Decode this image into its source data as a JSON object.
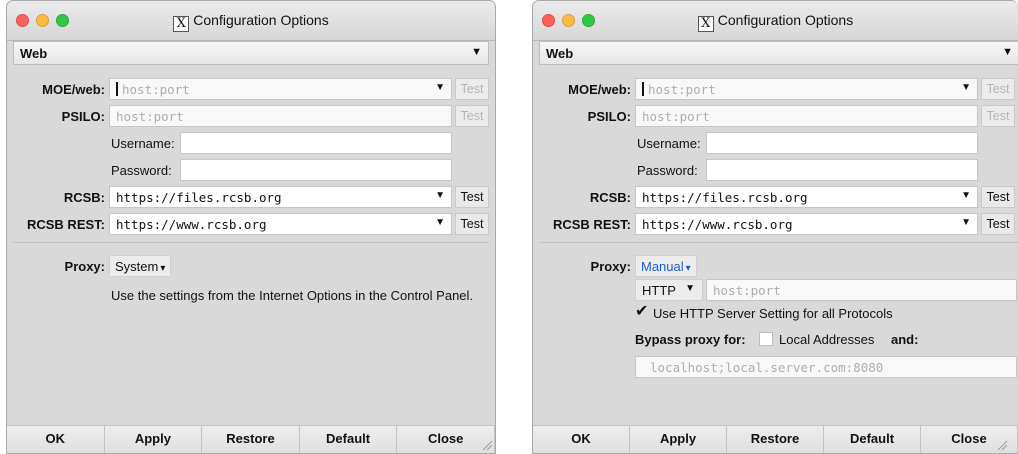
{
  "windows": [
    {
      "title": "Configuration Options",
      "category": "Web",
      "moe_web": {
        "label": "MOE/web:",
        "placeholder": "host:port",
        "test_label": "Test"
      },
      "psilo": {
        "label": "PSILO:",
        "placeholder": "host:port",
        "test_label": "Test"
      },
      "username": {
        "label": "Username:",
        "value": ""
      },
      "password": {
        "label": "Password:",
        "value": ""
      },
      "rcsb": {
        "label": "RCSB:",
        "value": "https://files.rcsb.org",
        "test_label": "Test"
      },
      "rcsb_rest": {
        "label": "RCSB REST:",
        "value": "https://www.rcsb.org",
        "test_label": "Test"
      },
      "proxy": {
        "label": "Proxy:",
        "value": "System",
        "arrow": "▾",
        "description": "Use the settings from the Internet Options in the Control Panel."
      },
      "buttons": [
        "OK",
        "Apply",
        "Restore",
        "Default",
        "Close"
      ]
    },
    {
      "title": "Configuration Options",
      "category": "Web",
      "moe_web": {
        "label": "MOE/web:",
        "placeholder": "host:port",
        "test_label": "Test"
      },
      "psilo": {
        "label": "PSILO:",
        "placeholder": "host:port",
        "test_label": "Test"
      },
      "username": {
        "label": "Username:",
        "value": ""
      },
      "password": {
        "label": "Password:",
        "value": ""
      },
      "rcsb": {
        "label": "RCSB:",
        "value": "https://files.rcsb.org",
        "test_label": "Test"
      },
      "rcsb_rest": {
        "label": "RCSB REST:",
        "value": "https://www.rcsb.org",
        "test_label": "Test"
      },
      "proxy": {
        "label": "Proxy:",
        "value": "Manual",
        "arrow": "▾",
        "protocol": "HTTP",
        "host_placeholder": "host:port",
        "use_http_for_all": "Use HTTP Server Setting for all Protocols",
        "use_http_checked": true,
        "bypass_label": "Bypass proxy for:",
        "local_addresses": "Local Addresses",
        "local_checked": false,
        "and_label": "and:",
        "bypass_placeholder": "localhost;local.server.com:8080"
      },
      "buttons": [
        "OK",
        "Apply",
        "Restore",
        "Default",
        "Close"
      ]
    }
  ],
  "colors": {
    "manual_accent": "#1b5dd6",
    "window_bg": "#d9d9d9"
  },
  "icons": {
    "window_icon": "x-window-icon",
    "dropdown": "triangle-down-icon",
    "check": "checkmark-icon"
  }
}
